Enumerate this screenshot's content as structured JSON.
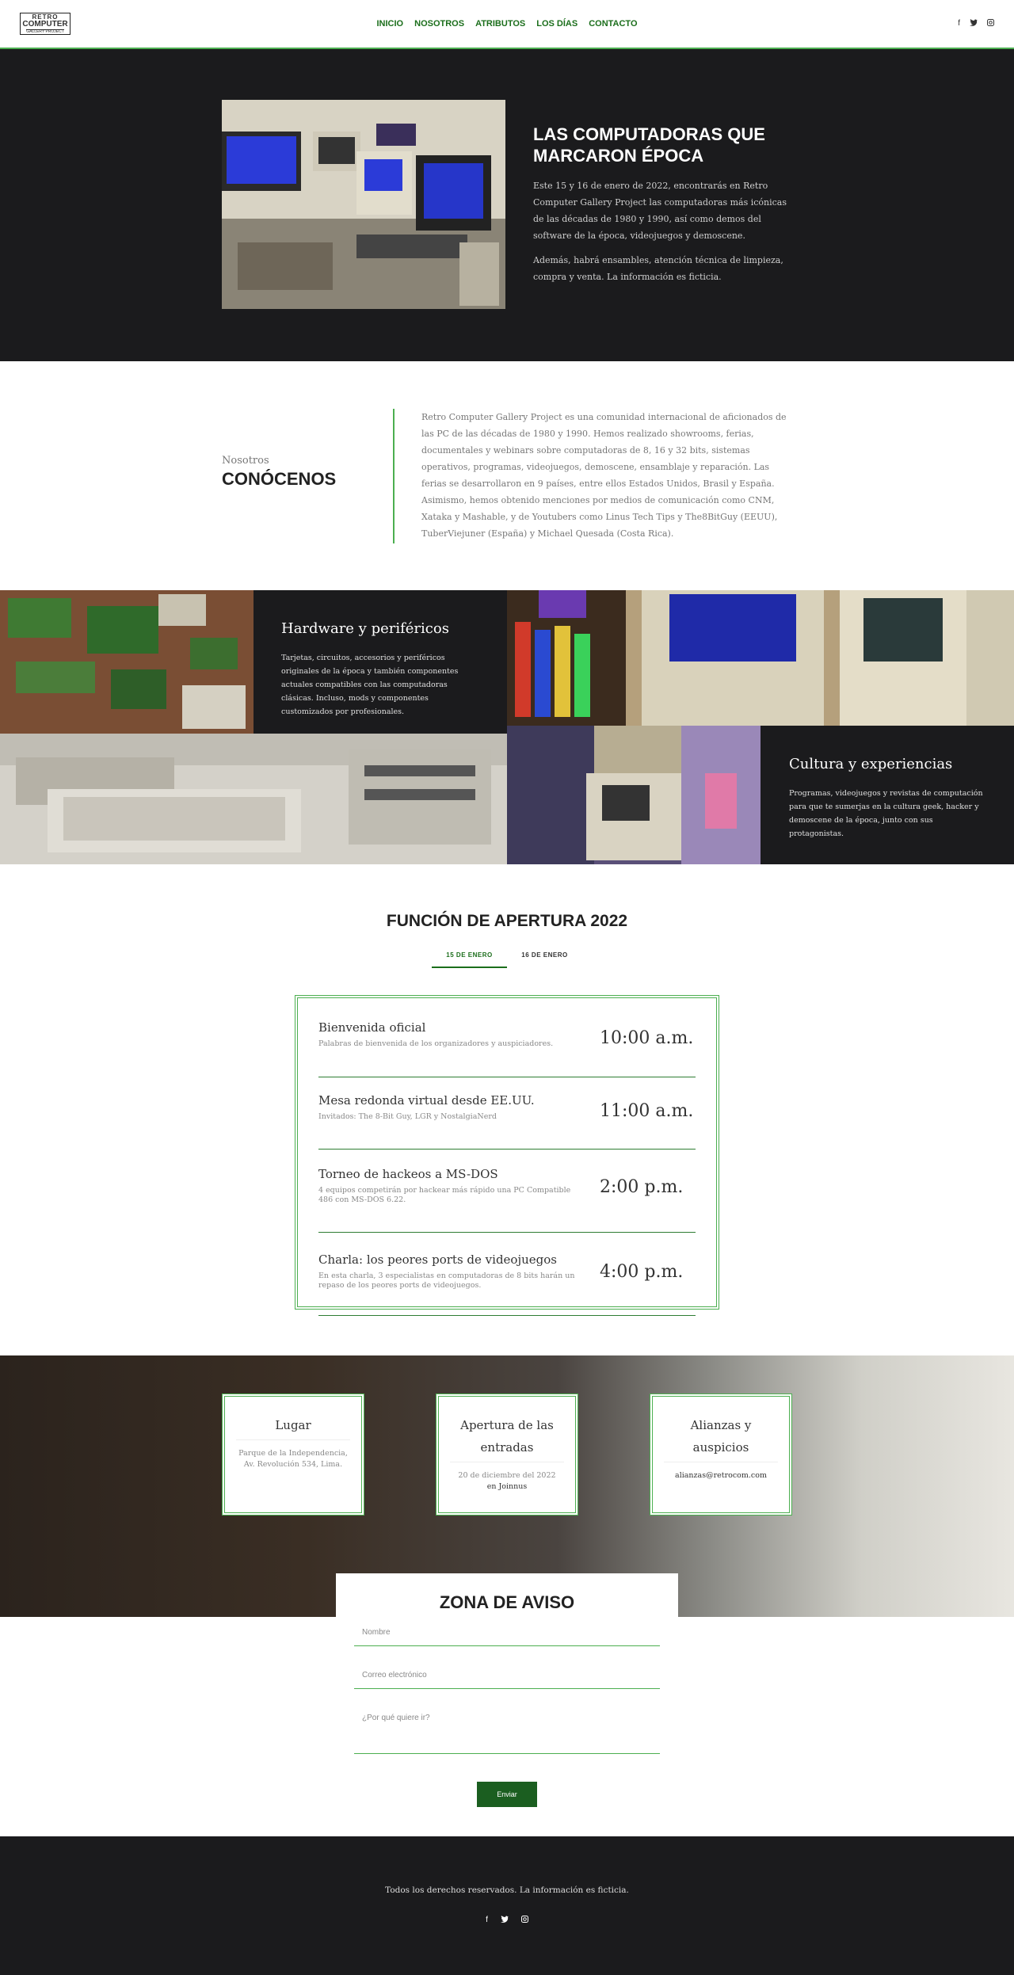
{
  "nav": {
    "logo_line1": "RETRO",
    "logo_line2": "COMPUTER",
    "logo_line3": "GALLERY PROJECT",
    "items": [
      "INICIO",
      "NOSOTROS",
      "ATRIBUTOS",
      "LOS DÍAS",
      "CONTACTO"
    ],
    "social_icons": [
      "facebook-icon",
      "twitter-icon",
      "instagram-icon"
    ]
  },
  "hero": {
    "title": "LAS COMPUTADORAS QUE MARCARON ÉPOCA",
    "p1": "Este 15 y 16 de enero de 2022, encontrarás en Retro Computer Gallery Project las computadoras más icónicas de las décadas de 1980 y 1990, así como demos del software de la época, videojuegos y demoscene.",
    "p2": "Además, habrá ensambles, atención técnica de limpieza, compra y venta. La información es ficticia."
  },
  "about": {
    "kicker": "Nosotros",
    "title": "CONÓCENOS",
    "text": "Retro Computer Gallery Project es una comunidad internacional de aficionados de las PC de las décadas de 1980 y 1990. Hemos realizado showrooms, ferias, documentales y webinars sobre computadoras de 8, 16 y 32 bits, sistemas operativos, programas, videojuegos, demoscene, ensamblaje y reparación. Las ferias se desarrollaron en 9 países, entre ellos Estados Unidos, Brasil y España. Asimismo, hemos obtenido menciones por medios de comunicación como CNM, Xataka y Mashable, y de Youtubers como Linus Tech Tips y The8BitGuy (EEUU), TuberViejuner (España) y Michael Quesada (Costa Rica)."
  },
  "gallery": {
    "hardware_title": "Hardware y periféricos",
    "hardware_text": "Tarjetas, circuitos, accesorios y periféricos originales de la época y también componentes actuales compatibles con las computadoras clásicas. Incluso, mods y componentes customizados por profesionales.",
    "culture_title": "Cultura y experiencias",
    "culture_text": "Programas, videojuegos y revistas de computación para que te sumerjas en la cultura geek, hacker y demoscene de la época, junto con sus protagonistas."
  },
  "schedule": {
    "title": "FUNCIÓN DE APERTURA 2022",
    "tabs": [
      "15 DE ENERO",
      "16 DE ENERO"
    ],
    "active_tab": "15 DE ENERO",
    "events": [
      {
        "title": "Bienvenida oficial",
        "desc": "Palabras de bienvenida de los organizadores y auspiciadores.",
        "time": "10:00 a.m."
      },
      {
        "title": "Mesa redonda virtual desde EE.UU.",
        "desc": "Invitados: The 8-Bit Guy, LGR y NostalgiaNerd",
        "time": "11:00 a.m."
      },
      {
        "title": "Torneo de hackeos a MS-DOS",
        "desc": "4 equipos competirán por hackear más rápido una PC Compatible 486 con MS-DOS 6.22.",
        "time": "2:00 p.m."
      },
      {
        "title": "Charla: los peores ports de videojuegos",
        "desc": "En esta charla, 3 especialistas en computadoras de 8 bits harán un repaso de los peores ports de videojuegos.",
        "time": "4:00 p.m."
      }
    ]
  },
  "info": {
    "place_title": "Lugar",
    "place_text": "Parque de la Independencia, Av. Revolución 534, Lima.",
    "tickets_title": "Apertura de las entradas",
    "tickets_date": "20 de diciembre del 2022",
    "tickets_where": "en Joinnus",
    "partners_title": "Alianzas y auspicios",
    "partners_email": "alianzas@retrocom.com"
  },
  "form": {
    "title": "ZONA DE AVISO",
    "name_placeholder": "Nombre",
    "email_placeholder": "Correo electrónico",
    "reason_placeholder": "¿Por qué quiere ir?",
    "submit": "Enviar"
  },
  "footer": {
    "text": "Todos los derechos reservados. La información es ficticia.",
    "social_icons": [
      "facebook-icon",
      "twitter-icon",
      "instagram-icon"
    ]
  },
  "colors": {
    "accent": "#4caf50",
    "nav_link": "#1b6e1b",
    "dark_bg": "#1b1b1d",
    "button": "#1b5e20"
  }
}
